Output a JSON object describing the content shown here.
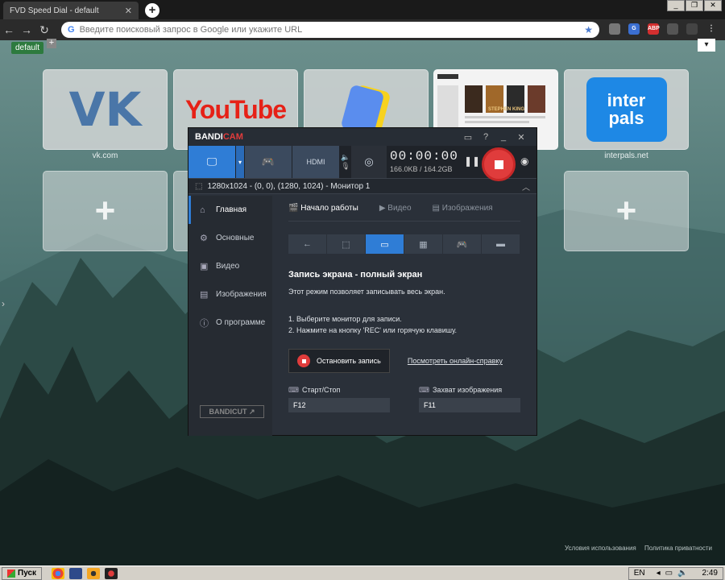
{
  "browser": {
    "tab_title": "FVD Speed Dial - default",
    "tab_close": "✕",
    "new_tab": "+",
    "win_controls": [
      "_",
      "❐",
      "✕"
    ],
    "address_placeholder": "Введите поисковый запрос в Google или укажите URL",
    "extensions": [
      "shield-icon",
      "translate-icon",
      "abp-icon",
      "cast-icon",
      "profile-icon",
      "menu-icon"
    ],
    "ext_labels": [
      "",
      "G",
      "ABP",
      "",
      "",
      ""
    ]
  },
  "speed_dial": {
    "group_name": "default",
    "group_add": "+",
    "collapse": "▾",
    "dials": [
      {
        "label": "vk.com",
        "logo": "VK"
      },
      {
        "label": "",
        "logo": "YouTube"
      },
      {
        "label": "",
        "logo": ""
      },
      {
        "label": "",
        "logo": "STEPHEN KING"
      },
      {
        "label": "interpals.net",
        "logo": "inter pals"
      }
    ],
    "empty_dials": 5,
    "plus": "+"
  },
  "bandicam": {
    "title_brand": "BANDI",
    "title_brand2": "CAM",
    "title_controls": [
      "▭",
      "?",
      "_",
      "✕"
    ],
    "timer": "00:00:00",
    "size": "166.0KB / 164.2GB",
    "pause": "❚❚",
    "camera": "◉",
    "area": "1280x1024 - (0, 0), (1280, 1024) - Монитор 1",
    "sidebar": [
      {
        "icon": "⌂",
        "label": "Главная"
      },
      {
        "icon": "⚙",
        "label": "Основные"
      },
      {
        "icon": "▣",
        "label": "Видео"
      },
      {
        "icon": "▤",
        "label": "Изображения"
      },
      {
        "icon": "ⓘ",
        "label": "О программе"
      }
    ],
    "bandicut": "BANDICUT ↗",
    "tabs": [
      "Начало работы",
      "Видео",
      "Изображения"
    ],
    "modes": [
      "←",
      "⬚",
      "▭",
      "▦",
      "🎮",
      "▬"
    ],
    "heading": "Запись экрана - полный экран",
    "description": "Этот режим позволяет записывать весь экран.",
    "step1": "1. Выберите монитор для записи.",
    "step2": "2. Нажмите на кнопку 'REC' или горячую клавишу.",
    "stop_button": "Остановить запись",
    "help_link": "Посмотреть онлайн-справку",
    "hotkey_start_label": "Старт/Стоп",
    "hotkey_start_value": "F12",
    "hotkey_capture_label": "Захват изображения",
    "hotkey_capture_value": "F11",
    "accent_color": "#2f7dd6",
    "rec_color": "#e03c3c"
  },
  "footer": {
    "terms": "Условия использования",
    "privacy": "Политика приватности"
  },
  "taskbar": {
    "start": "Пуск",
    "lang": "EN",
    "time": "2:49"
  }
}
